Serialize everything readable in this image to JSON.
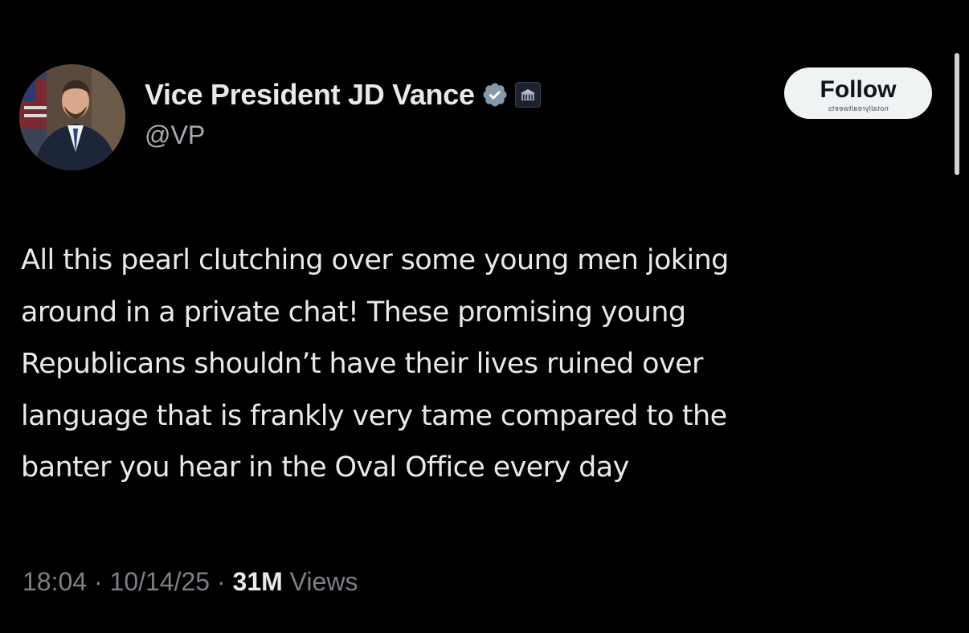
{
  "author": {
    "display_name": "Vice President JD Vance",
    "handle": "@VP",
    "verified_badge_color": "#829aab",
    "verified_icon": "verified-badge-icon",
    "affiliation_icon": "white-house-badge-icon"
  },
  "actions": {
    "follow_label": "Follow",
    "follow_watermark": "notallyrealtweets"
  },
  "tweet": {
    "text": "All this pearl clutching over some young men joking\naround in a private chat! These promising young\nRepublicans shouldn’t have their lives ruined over\nlanguage that is frankly very tame compared to the\nbanter you hear in the Oval Office every day"
  },
  "meta": {
    "time": "18:04",
    "separator": "·",
    "date": "10/14/25",
    "views_count": "31M",
    "views_label": "Views"
  },
  "theme": {
    "background": "#000000",
    "text": "#e7e9ea",
    "muted": "#7b8086",
    "follow_bg": "#eff3f4"
  }
}
